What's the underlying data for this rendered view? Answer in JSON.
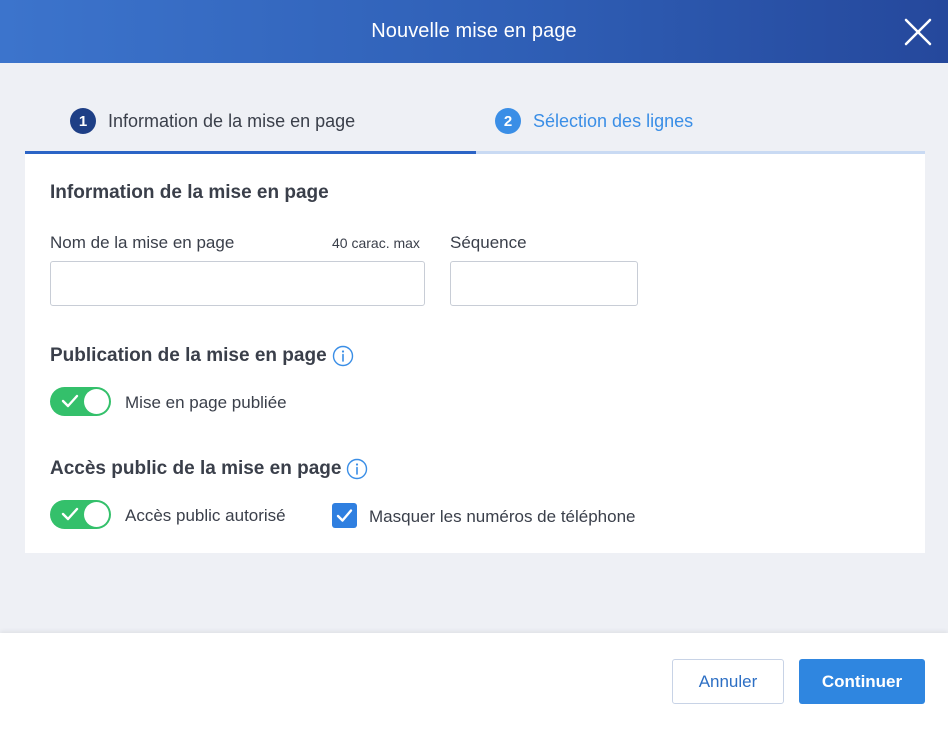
{
  "dialog": {
    "title": "Nouvelle mise en page",
    "close_icon": "close-icon"
  },
  "steps": [
    {
      "number": "1",
      "label": "Information de la mise en page",
      "active": true
    },
    {
      "number": "2",
      "label": "Sélection des lignes",
      "active": false
    }
  ],
  "form": {
    "section_info_title": "Information de la mise en page",
    "name_label": "Nom de la mise en page",
    "name_hint": "40 carac. max",
    "name_value": "",
    "sequence_label": "Séquence",
    "sequence_value": "",
    "section_publication_title": "Publication de la mise en page",
    "published_toggle_label": "Mise en page publiée",
    "published_toggle_on": true,
    "section_access_title": "Accès public de la mise en page",
    "public_access_toggle_label": "Accès public autorisé",
    "public_access_toggle_on": true,
    "hide_phone_label": "Masquer les numéros de téléphone",
    "hide_phone_checked": true
  },
  "footer": {
    "cancel_label": "Annuler",
    "continue_label": "Continuer"
  },
  "colors": {
    "header_gradient_start": "#3c74cc",
    "header_gradient_end": "#25489c",
    "toggle_on": "#34c06b",
    "primary": "#2f86e0",
    "step_active": "#1e3f86",
    "step_inactive": "#3a8ee6"
  }
}
